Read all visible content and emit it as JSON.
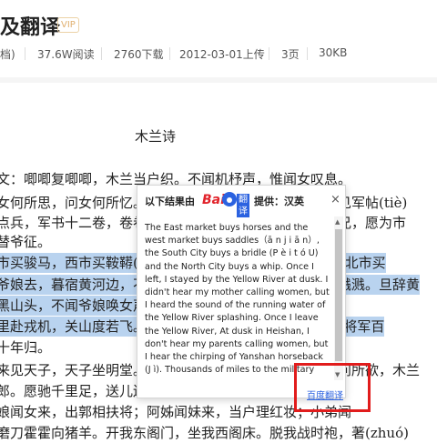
{
  "doc": {
    "title": "及翻译",
    "vip": "VIP",
    "meta": [
      "档)",
      "37.6W阅读",
      "2760下载",
      "2012-03-01上传",
      "3页",
      "30KB"
    ],
    "poem_title": "木兰诗",
    "lines": [
      "文：唧唧复唧唧，木兰当户织。不闻机杼声，惟闻女叹息。",
      "女何所思，问女何所忆。女亦无所思，女亦无所忆。昨夜见军帖(tiè)",
      "点兵，军书十二卷，卷卷有爷名。阿爷无大儿，木兰无长兄，愿为市",
      "替爷征。",
      "市买骏马，西市买鞍鞯(ān jiān)，南市买辔头(pèi tóu)，北市买",
      "爷娘去，暮宿黄河边，不闻爷娘唤女声，但闻黄河流水鸣溅溅。旦辞黄",
      "黑山头，不闻爷娘唤女声，但闻燕山胡骑(jì)鸣啾啾(jiū)。",
      "里赴戎机，关山度若飞。朔气传金柝(tuò)，寒光照铁衣。将军百",
      "十年归。",
      "来见天子，天子坐明堂。策勋十二转，赏赐百千强。可汗问所欲，木兰",
      "郎。愿驰千里足，送儿还故乡。",
      "娘闻女来，出郭相扶将；阿姊闻妹来，当户理红妆；小弟闻",
      "磨刀霍霍向猪羊。开我东阁门，坐我西阁床。脱我战时袍，著(zhuó)"
    ]
  },
  "popup": {
    "prefix": "以下结果由",
    "logo_bai": "Bai",
    "logo_fanyi": "翻译",
    "suffix": "提供：汉英",
    "close": "×",
    "translation": "The East market buys horses and the west market buys saddles（ā n j i ā n）, the South City buys a bridle (P è i t ó U) and the North City buys a whip. Once I left, I stayed by the Yellow River at dusk. I didn't hear my mother calling women, but I heard the sound of the running water of the Yellow River splashing. Once I leave the Yellow River, At dusk in Heishan, I don't hear my parents calling women, but I hear the chirping of Yanshan horseback (J ì). Thousands of miles to the military",
    "link": "百度翻译",
    "arrow_up": "▲",
    "arrow_down": "▼"
  },
  "colors": {
    "highlight": "#b9d3ef",
    "link": "#2b62e0",
    "annotation": "#e11c1c",
    "baidu_red": "#e1232b"
  }
}
